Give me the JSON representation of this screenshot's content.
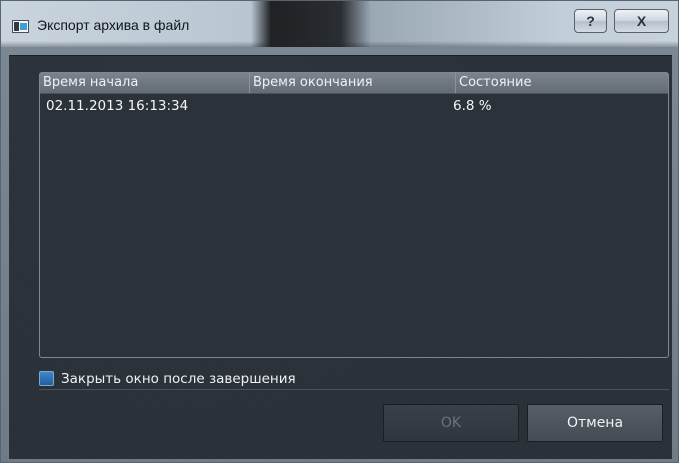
{
  "window": {
    "title": "Экспорт архива в файл",
    "help_label": "?",
    "close_label": "X"
  },
  "list": {
    "columns": [
      "Время начала",
      "Время окончания",
      "Состояние"
    ],
    "rows": [
      {
        "start": "02.11.2013 16:13:34",
        "end": "",
        "status": "6.8 %"
      }
    ]
  },
  "options": {
    "close_after_label": "Закрыть окно после завершения",
    "close_after_checked": true
  },
  "buttons": {
    "ok_label": "OK",
    "ok_enabled": false,
    "cancel_label": "Отмена"
  },
  "colors": {
    "accent": "#2f74b8",
    "background": "#2b3139"
  }
}
